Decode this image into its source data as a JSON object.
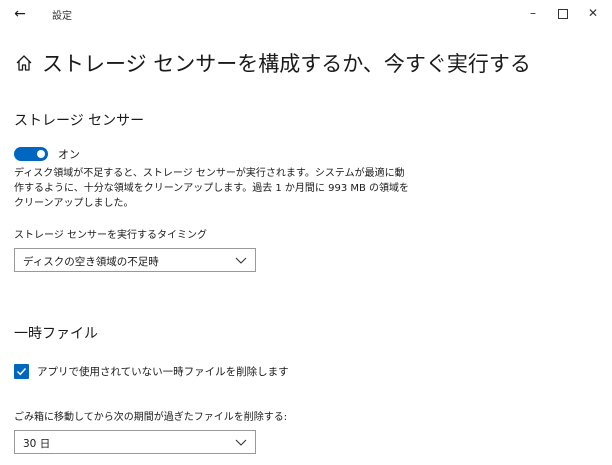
{
  "window": {
    "title": "設定",
    "back_glyph": "←",
    "minimize_glyph": "–",
    "close_glyph": "✕"
  },
  "header": {
    "icon": "home-icon",
    "title": "ストレージ センサーを構成するか、今すぐ実行する"
  },
  "storage_sense": {
    "section_title": "ストレージ センサー",
    "toggle_state_label": "オン",
    "toggle_on": true,
    "description": "ディスク領域が不足すると、ストレージ センサーが実行されます。システムが最適に動作するように、十分な領域をクリーンアップします。過去 1 か月間に 993 MB の領域をクリーンアップしました。",
    "run_timing_label": "ストレージ センサーを実行するタイミング",
    "run_timing_value": "ディスクの空き領域の不足時"
  },
  "temp_files": {
    "section_title": "一時ファイル",
    "checkbox_label": "アプリで使用されていない一時ファイルを削除します",
    "checkbox_checked": true,
    "recycle_label": "ごみ箱に移動してから次の期間が過ぎたファイルを削除する:",
    "recycle_value": "30 日"
  },
  "colors": {
    "accent": "#0067c0",
    "text": "#1a1a1a",
    "border": "#999999"
  }
}
